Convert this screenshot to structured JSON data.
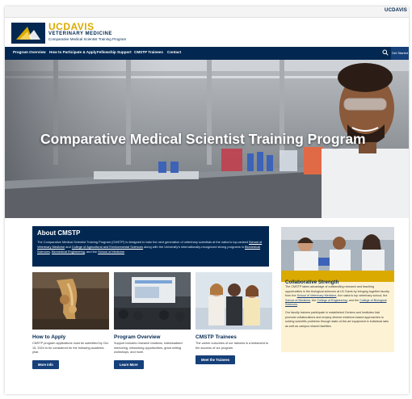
{
  "header": {
    "util_right": "UCDAVIS",
    "brand_uc": "UCDAVIS",
    "brand_vm": "VETERINARY MEDICINE",
    "brand_sub": "Comparative Medical Scientist Training Program"
  },
  "nav": {
    "items": [
      "Program Overview",
      "How to Participate & Apply",
      "Fellowship Support",
      "CMSTP Trainees",
      "Contact"
    ],
    "search_icon": "search-icon",
    "visit_label": "Get Started"
  },
  "hero": {
    "title": "Comparative Medical Scientist Training Program"
  },
  "about": {
    "heading": "About CMSTP",
    "text_1": "The Comparative Medical Scientist Training Program (CMSTP) is designed to train the next generation of veterinary scientists at the nation's top-ranked ",
    "link_1": "School of Veterinary Medicine",
    "text_2": " and ",
    "link_2": "College of Agricultural and Environmental Sciences",
    "text_3": " along with the University's internationally-recognized strong programs in ",
    "link_3": "Biomedical Sciences",
    "text_4": ", ",
    "link_4": "Biomedical Engineering",
    "text_5": ", and the ",
    "link_5": "School of Medicine",
    "text_6": "."
  },
  "cards": [
    {
      "title": "How to Apply",
      "text": "CMSTP program applications must be submitted by Oct. 15, 2024 to be considered for the following academic year.",
      "button": "More Info"
    },
    {
      "title": "Program Overview",
      "text": "Support includes research rotations, individualized mentoring, networking opportunities, grant writing workshops, and more.",
      "button": "Learn More"
    },
    {
      "title": "CMSTP Trainees",
      "text": "The career outcomes of our trainees is a testament to the success of our program.",
      "button": "Meet the Trainees"
    }
  ],
  "side": {
    "heading": "Collaborative Strength",
    "p1_text": "The CMSTP takes advantage of outstanding research and teaching opportunities in the biological sciences at UC Davis by bringing together faculty from the ",
    "p1_link1": "School of Veterinary Medicine",
    "p1_mid": ", the nation's top veterinary school, the ",
    "p1_link2": "School of Medicine",
    "p1_mid2": ", the ",
    "p1_link3": "College of Engineering",
    "p1_mid3": ", and the ",
    "p1_link4": "College of Biological Sciences",
    "p1_end": ".",
    "p2": "Our faculty trainers participate in established Centers and Institutes that promote collaborations and employ diverse evidence-based approaches to solving scientific problems through state-of-the-art equipment in individual labs as well as campus shared facilities."
  },
  "colors": {
    "navy": "#022851",
    "gold": "#daaa00",
    "button_blue": "#16407a",
    "side_bg": "#fdf3d4"
  }
}
